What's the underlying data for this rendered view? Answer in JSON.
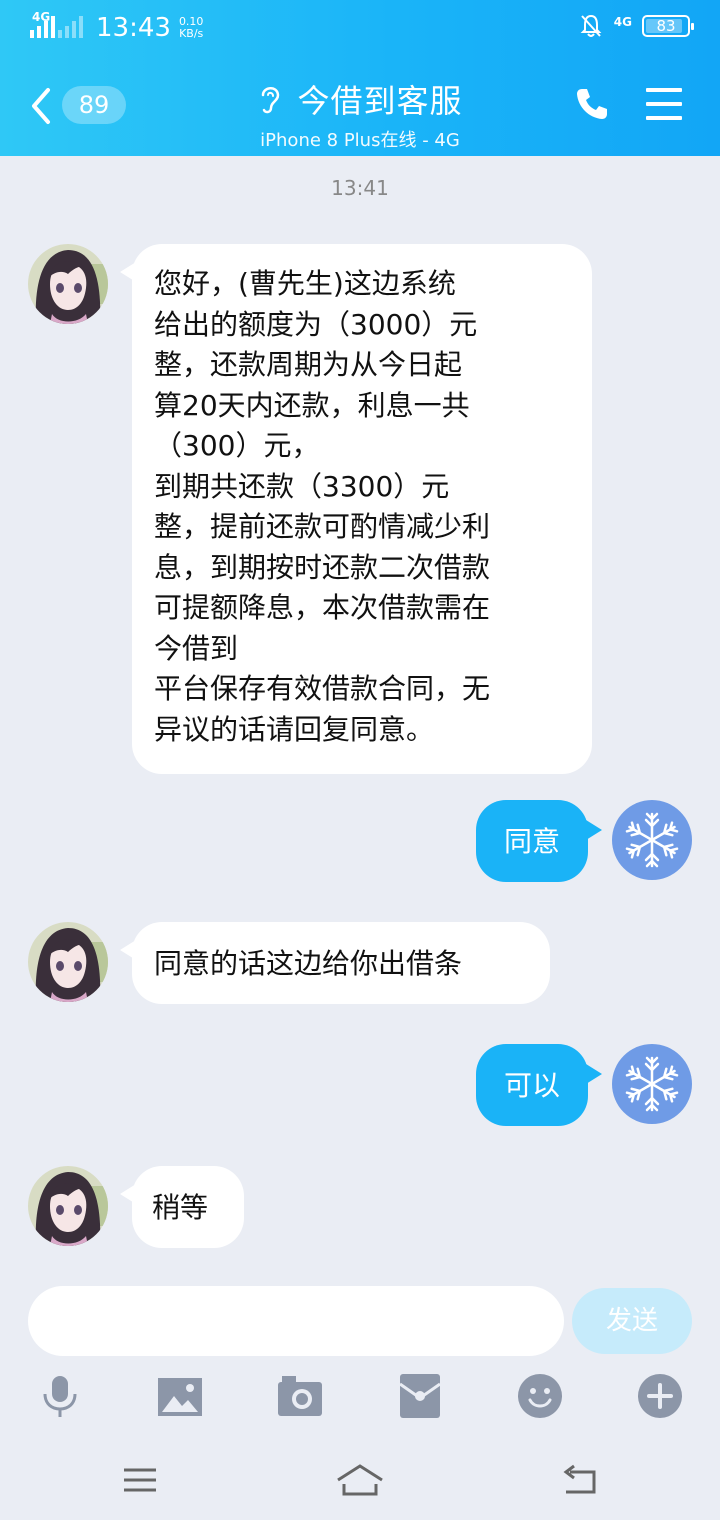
{
  "status_bar": {
    "network_left": "4G",
    "time": "13:43",
    "speed_value": "0.10",
    "speed_unit": "KB/s",
    "network_right": "4G",
    "battery": "83"
  },
  "header": {
    "unread_count": "89",
    "title": "今借到客服",
    "subtitle": "iPhone 8 Plus在线 - 4G"
  },
  "chat": {
    "timestamp": "13:41",
    "messages": [
      {
        "side": "in",
        "lines": [
          "您好，(曹先生)这边系统",
          "给出的额度为（3000）元",
          "整，还款周期为从今日起",
          "算20天内还款，利息一共",
          "（300）元，",
          "到期共还款（3300）元",
          "整，提前还款可酌情减少利",
          "息，到期按时还款二次借款",
          "可提额降息，本次借款需在",
          "今借到",
          "平台保存有效借款合同，无",
          "异议的话请回复同意。"
        ]
      },
      {
        "side": "out",
        "text": "同意"
      },
      {
        "side": "in",
        "text": "同意的话这边给你出借条"
      },
      {
        "side": "out",
        "text": "可以"
      },
      {
        "side": "in",
        "text": "稍等"
      }
    ]
  },
  "composer": {
    "input_value": "",
    "send_label": "发送"
  },
  "toolbar": {
    "icons": [
      "microphone-icon",
      "image-icon",
      "camera-icon",
      "red-packet-icon",
      "emoji-icon",
      "plus-icon"
    ]
  },
  "colors": {
    "header": "#1ab4f8",
    "outgoing_bubble": "#1ab3f7",
    "chat_background": "#eaedf4",
    "send_button": "#c6ebfb",
    "toolbar_icon": "#8c96a8"
  }
}
